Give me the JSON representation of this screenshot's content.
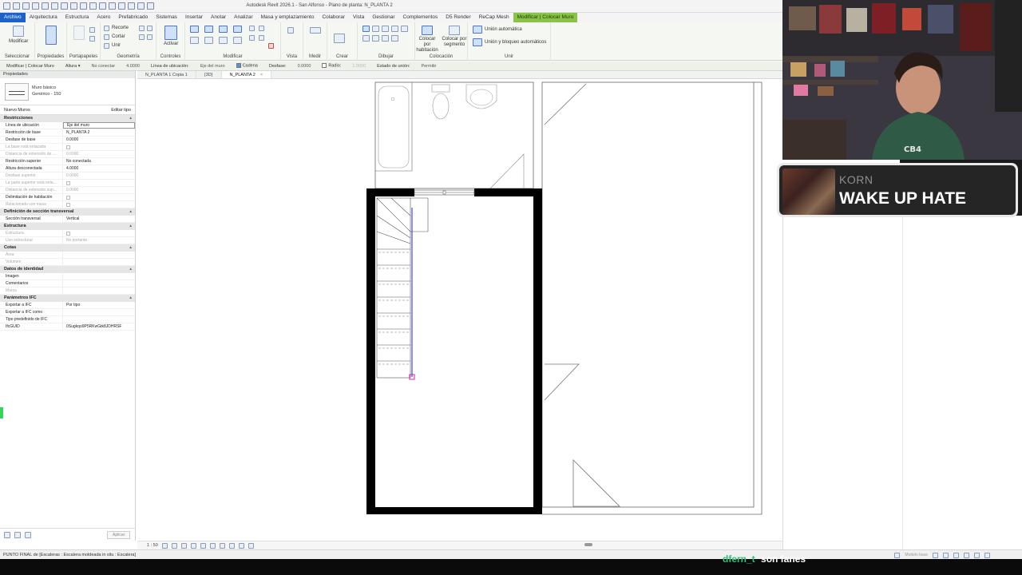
{
  "window": {
    "title": "Autodesk Revit 2026.1 - San Alfonso - Plano de planta: N_PLANTA 2"
  },
  "menu": {
    "file": "Archivo",
    "tabs": [
      "Arquitectura",
      "Estructura",
      "Acero",
      "Prefabricado",
      "Sistemas",
      "Insertar",
      "Anotar",
      "Analizar",
      "Masa y emplazamiento",
      "Colaborar",
      "Vista",
      "Gestionar",
      "Complementos",
      "D5 Render",
      "ReCap Mesh"
    ],
    "active_tab": "Modificar | Colocar Muro"
  },
  "ribbon": {
    "modify": "Modificar",
    "recorte": "Recorte",
    "cortar": "Cortar",
    "unir": "Unir",
    "activar": "Activar",
    "place_room": "Colocar por habitación",
    "place_segment": "Colocar por segmento",
    "auto_join": "Unión automática",
    "join_lock": "Unión y bloqueo automáticos",
    "groups": [
      "Seleccionar",
      "Propiedades",
      "Portapapeles",
      "Geometría",
      "Controles",
      "Modificar",
      "Vista",
      "Medir",
      "Crear",
      "Dibujar",
      "Colocación",
      "Unir"
    ]
  },
  "options_bar": {
    "context": "Modificar | Colocar Muro",
    "altura_label": "Altura",
    "altura_value": "No conectar",
    "altura_num": "4.0000",
    "location_label": "Línea de ubicación:",
    "location_value": "Eje del muro",
    "cadena": "Cadena",
    "desfase_label": "Desfase:",
    "desfase_value": "0.0000",
    "radio": "Radio:",
    "radio_value": "1.0000",
    "join_status_label": "Estado de unión:",
    "join_status_value": "Permitir"
  },
  "properties": {
    "header": "Propiedades",
    "type_family": "Muro básico",
    "type_name": "Genérico - 150",
    "instance": "Nuevo Muros",
    "edit_type": "Editar tipo",
    "sections": [
      {
        "title": "Restricciones",
        "rows": [
          {
            "k": "Línea de ubicación",
            "v": "Eje del muro",
            "edit": true
          },
          {
            "k": "Restricción de base",
            "v": "N_PLANTA 2"
          },
          {
            "k": "Desfase de base",
            "v": "0.0000"
          },
          {
            "k": "La base está enlazada",
            "v": "",
            "dim": true,
            "chk": true
          },
          {
            "k": "Distancia de extensión de ...",
            "v": "0.0000",
            "dim": true
          },
          {
            "k": "Restricción superior",
            "v": "No conectada"
          },
          {
            "k": "Altura desconectada",
            "v": "4.0000"
          },
          {
            "k": "Desfase superior",
            "v": "0.0000",
            "dim": true
          },
          {
            "k": "La parte superior está enla...",
            "v": "",
            "dim": true,
            "chk": true
          },
          {
            "k": "Distancia de extensión sup...",
            "v": "0.0000",
            "dim": true
          },
          {
            "k": "Delimitación de habitación",
            "v": "",
            "chk": true
          },
          {
            "k": "Relacionado con masa",
            "v": "",
            "dim": true,
            "chk": true
          }
        ]
      },
      {
        "title": "Definición de sección transversal",
        "rows": [
          {
            "k": "Sección transversal",
            "v": "Vertical"
          }
        ]
      },
      {
        "title": "Estructura",
        "rows": [
          {
            "k": "Estructura",
            "v": "",
            "dim": true,
            "chk": true
          },
          {
            "k": "Uso estructural",
            "v": "No portante",
            "dim": true
          }
        ]
      },
      {
        "title": "Cotas",
        "rows": [
          {
            "k": "Área",
            "v": "",
            "dim": true
          },
          {
            "k": "Volumen",
            "v": "",
            "dim": true
          }
        ]
      },
      {
        "title": "Datos de identidad",
        "rows": [
          {
            "k": "Imagen",
            "v": ""
          },
          {
            "k": "Comentarios",
            "v": ""
          },
          {
            "k": "Marca",
            "v": "",
            "dim": true
          }
        ]
      },
      {
        "title": "Parámetros IFC",
        "rows": [
          {
            "k": "Exportar a IFC",
            "v": "Por tipo"
          },
          {
            "k": "Exportar a IFC como",
            "v": ""
          },
          {
            "k": "Tipo predefinido de IFC",
            "v": ""
          },
          {
            "k": "IfcGUID",
            "v": "0Sugkqo9P5RKwGtk8JDHRSF"
          }
        ]
      }
    ],
    "apply": "Aplicar"
  },
  "view_tabs": [
    {
      "label": "N_PLANTA 1 Copia 1",
      "active": false
    },
    {
      "label": "{3D}",
      "active": false
    },
    {
      "label": "N_PLANTA 2",
      "active": true
    }
  ],
  "view_control": {
    "scale": "1 : 50"
  },
  "status": {
    "text": "PUNTO FINAL de [Escaleras : Escalera moldeada in situ : Escalera]",
    "model": "Modelo base"
  },
  "now_playing": {
    "artist": "KORN",
    "title": "WAKE UP HATE"
  },
  "chat": {
    "user": "dfern_t",
    "message": "son fanes"
  },
  "colors": {
    "accent_green": "#8bc34a",
    "file_blue": "#1e62c8",
    "stair_blue": "#3a4fd8",
    "endpoint_magenta": "#d01fb0"
  }
}
